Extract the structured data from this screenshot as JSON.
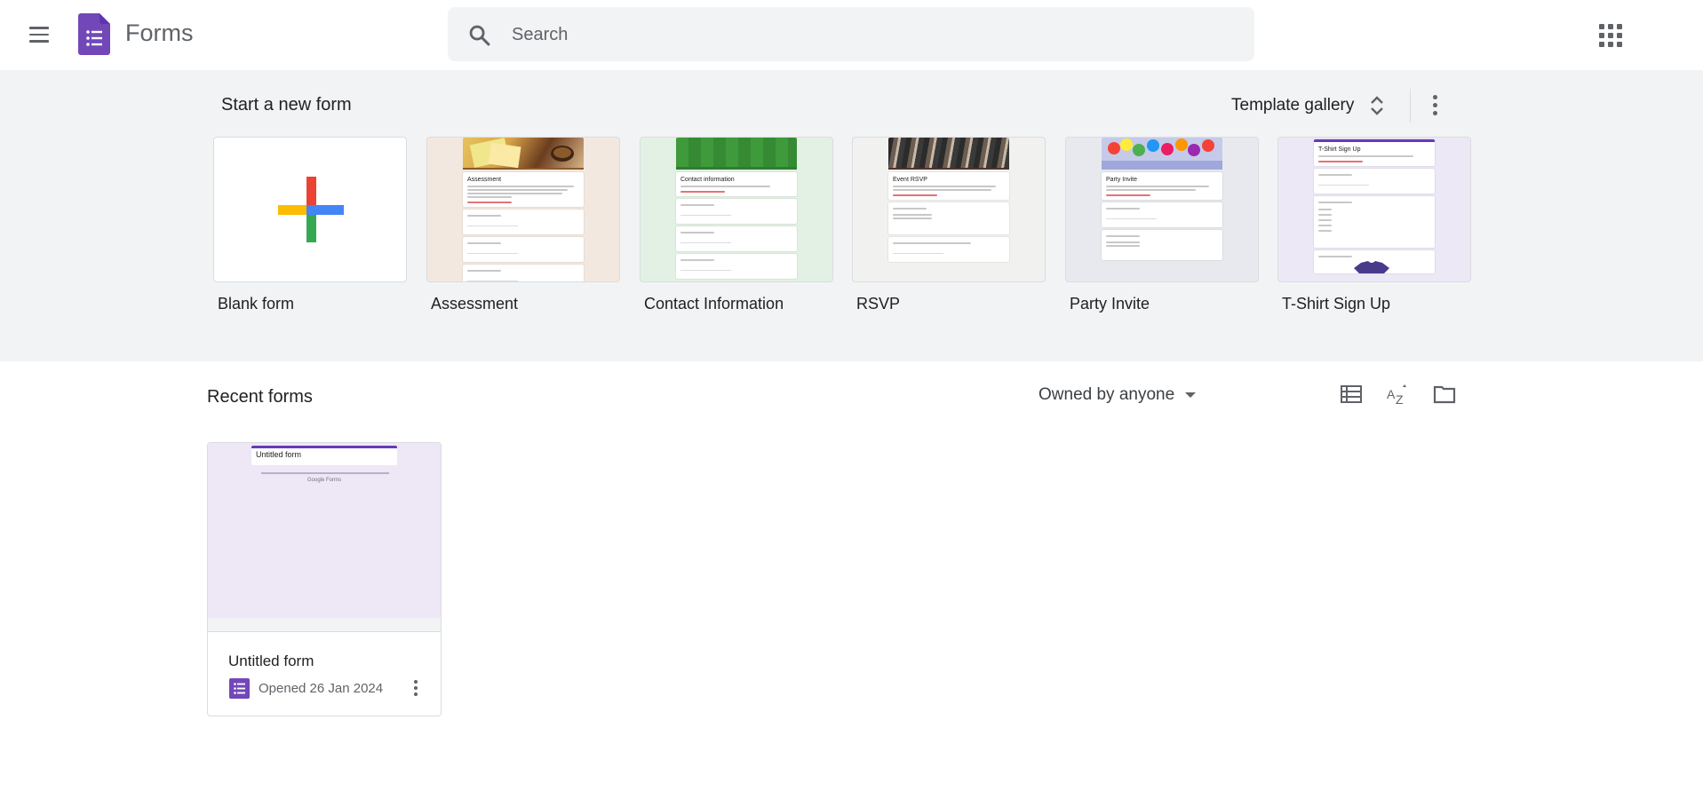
{
  "header": {
    "app_title": "Forms",
    "search_placeholder": "Search",
    "menu_icon": "hamburger-menu-icon",
    "apps_icon": "apps-grid-icon"
  },
  "templates": {
    "section_title": "Start a new form",
    "gallery_label": "Template gallery",
    "items": [
      {
        "label": "Blank form",
        "thumb": "Blank"
      },
      {
        "label": "Assessment",
        "thumb": "Assessment"
      },
      {
        "label": "Contact Information",
        "thumb": "Contact information"
      },
      {
        "label": "RSVP",
        "thumb": "Event RSVP"
      },
      {
        "label": "Party Invite",
        "thumb": "Party Invite"
      },
      {
        "label": "T-Shirt Sign Up",
        "thumb": "T-Shirt Sign Up"
      }
    ]
  },
  "recent": {
    "section_title": "Recent forms",
    "owner_filter": "Owned by anyone",
    "view_icons": [
      "list-view-icon",
      "sort-az-icon",
      "folder-icon"
    ],
    "forms": [
      {
        "name": "Untitled form",
        "thumb_title": "Untitled form",
        "thumb_footer": "Google Forms",
        "meta": "Opened 26 Jan 2024"
      }
    ]
  },
  "colors": {
    "forms_purple": "#7248b9",
    "band_bg": "#f1f3f4",
    "thumb_purple_bg": "#ede7f6",
    "google_red": "#ea4335",
    "google_blue": "#4285f4",
    "google_yellow": "#fbbc04",
    "google_green": "#34a853"
  }
}
